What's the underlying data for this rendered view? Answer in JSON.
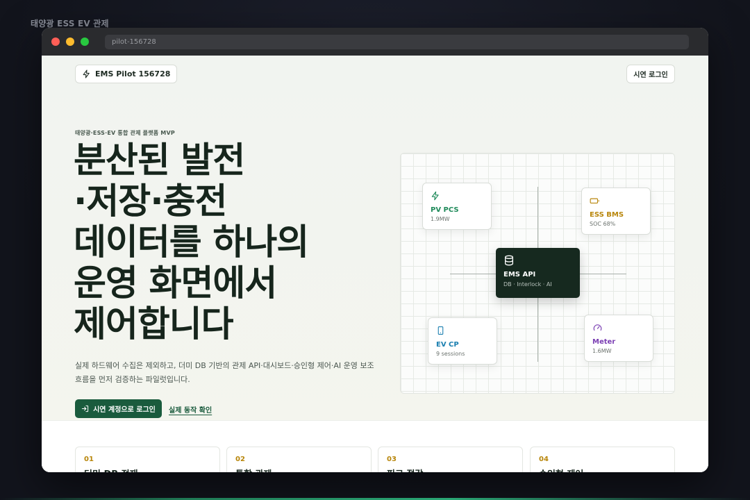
{
  "page": {
    "outer_title": "태양광 ESS EV 관제"
  },
  "browser": {
    "url": "pilot-156728"
  },
  "header": {
    "brand": "EMS Pilot 156728",
    "login_button": "시연 로그인"
  },
  "hero": {
    "eyebrow": "태양광·ESS·EV 통합 관제 플랫폼 MVP",
    "headline_lines": [
      "분산된 발전",
      "·저장·충전",
      "데이터를 하나의",
      "운영 화면에서",
      "제어합니다"
    ],
    "description_lines": [
      "실제 하드웨어 수집은 제외하고, 더미 DB 기반의 관제 API·대시보드·승인형 제어·AI 운영 보조",
      "흐름을 먼저 검증하는 파일럿입니다."
    ],
    "cta_primary": "시연 계정으로 로그인",
    "cta_secondary": "실제 동작 확인"
  },
  "diagram": {
    "nodes": {
      "pv": {
        "label": "PV PCS",
        "sub": "1.9MW",
        "color": "#1f8a5a",
        "icon": "bolt-icon"
      },
      "ess": {
        "label": "ESS BMS",
        "sub": "SOC 68%",
        "color": "#b8860b",
        "icon": "battery-icon"
      },
      "center": {
        "label": "EMS API",
        "sub": "DB · Interlock · AI",
        "icon": "database-icon"
      },
      "ev": {
        "label": "EV CP",
        "sub": "9 sessions",
        "color": "#1a7fb0",
        "icon": "phone-icon"
      },
      "meter": {
        "label": "Meter",
        "sub": "1.6MW",
        "color": "#7b3fb3",
        "icon": "gauge-icon"
      }
    }
  },
  "features": [
    {
      "num": "01",
      "title": "더미 DB 적재"
    },
    {
      "num": "02",
      "title": "통합 관제"
    },
    {
      "num": "03",
      "title": "피크 절감"
    },
    {
      "num": "04",
      "title": "승인형 제어"
    }
  ]
}
